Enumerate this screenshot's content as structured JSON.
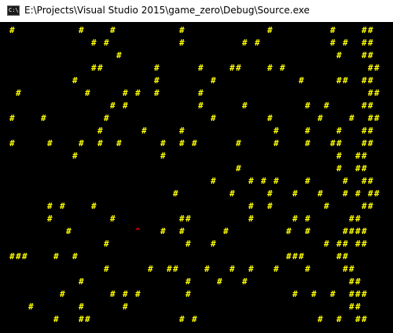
{
  "window": {
    "title": "E:\\Projects\\Visual Studio 2015\\game_zero\\Debug\\Source.exe",
    "icon": "console-app-icon",
    "icon_glyph": "C:\\"
  },
  "console": {
    "background": "#000000",
    "wall_color": "#ffff00",
    "player_color": "#ff0000",
    "wall_char": "#",
    "player_char": "^",
    "columns": 62,
    "rows": 25,
    "lines": [
      " #          #    #          #             #         #    ##",
      "              # #           #         # #           # #  ##",
      "                  #                                  #   ##",
      "              ##        #      #    ##    # #             ##",
      "           #            #        #             #     ##  ##",
      "  #          #     # #  #      #                          ##",
      "                 # #           #      #         #  #     ##",
      " #    #         #                #        #       #    #  ##",
      "               #      #     #              #    #    #   ##",
      " #     #    #  #  #      #  # #      #     #    #   ##   ##",
      "           #             #                           #  ##",
      "                                     #               #  ##",
      "                                 #     # # #    #     #  ##",
      "                           #        #     #   #   #   # # ##",
      "       # #    #                        #  #        #     ##",
      "       #         #          ##         #      # #      ##",
      "          #          ^   #  #      #         #  #     ####",
      "                #            #   #                 # ## ##",
      " ###    #  #                                 ###     ##",
      "                #      #  ##    #   #  #   #    #     ##",
      "            #                #    #   #                ##",
      "         #       # # #       #                #  #  #  ###",
      "    #       #      #                                   ##",
      "        #   ##              # #                   #  #  ##"
    ]
  }
}
